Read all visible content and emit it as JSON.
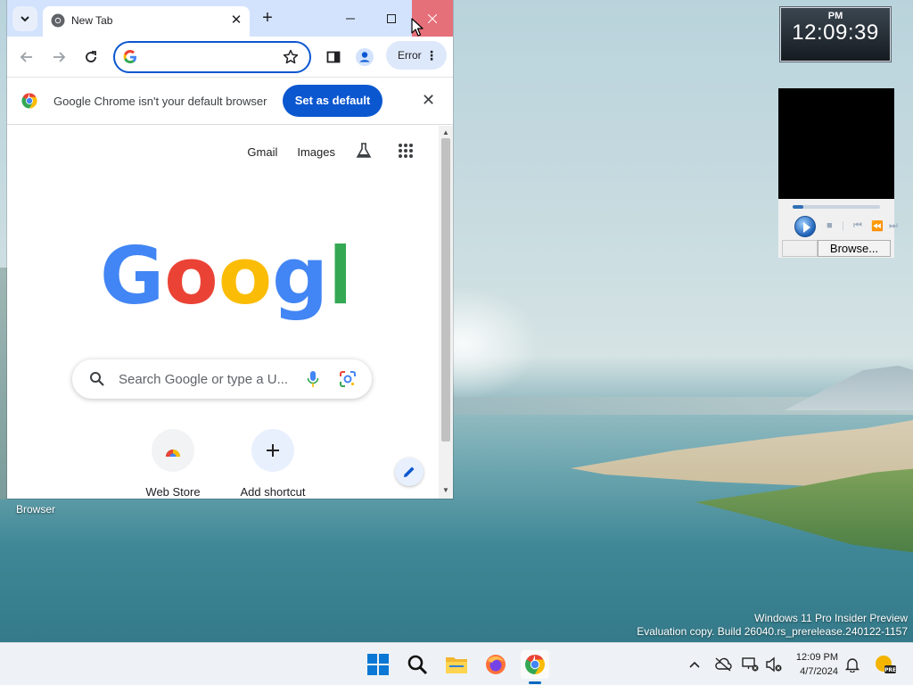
{
  "desktop": {
    "icon_label": "Browser",
    "watermark_line1": "Windows 11 Pro Insider Preview",
    "watermark_line2": "Evaluation copy. Build 26040.rs_prerelease.240122-1157"
  },
  "clock_gadget": {
    "ampm": "PM",
    "time": "12:09:39"
  },
  "media_gadget": {
    "browse_label": "Browse...",
    "seek_progress": 0.12
  },
  "chrome": {
    "tab_title": "New Tab",
    "omnibox_value": "",
    "profile_chip": "Error",
    "infobar_message": "Google Chrome isn't your default browser",
    "infobar_button": "Set as default",
    "ntp": {
      "link_gmail": "Gmail",
      "link_images": "Images",
      "search_placeholder": "Search Google or type a U...",
      "shortcuts": [
        {
          "label": "Web Store",
          "icon": "chrome-webstore-icon"
        },
        {
          "label": "Add shortcut",
          "icon": "plus-icon"
        }
      ]
    }
  },
  "taskbar": {
    "apps": [
      "windows-start-icon",
      "search-icon",
      "file-explorer-icon",
      "firefox-icon",
      "chrome-icon"
    ],
    "active_app": "chrome-icon",
    "clock_time": "12:09 PM",
    "clock_date": "4/7/2024"
  },
  "colors": {
    "accent": "#0b57d0",
    "tabstrip": "#d3e3fd",
    "close_hover": "#e5707a",
    "taskbar": "#eef2f6"
  }
}
